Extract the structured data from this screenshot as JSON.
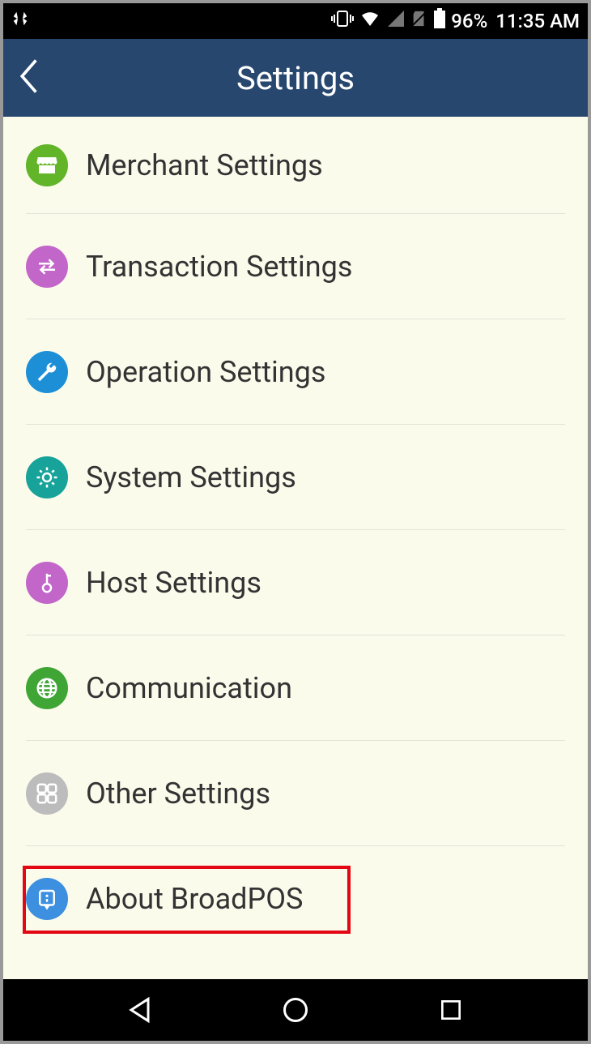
{
  "statusbar": {
    "battery_pct": "96%",
    "time": "11:35 AM"
  },
  "navbar": {
    "title": "Settings"
  },
  "settings": {
    "items": [
      {
        "label": "Merchant Settings",
        "icon": "store-icon",
        "color": "c-green"
      },
      {
        "label": "Transaction Settings",
        "icon": "swap-icon",
        "color": "c-violet"
      },
      {
        "label": "Operation Settings",
        "icon": "wrench-icon",
        "color": "c-blue"
      },
      {
        "label": "System Settings",
        "icon": "gear-icon",
        "color": "c-teal"
      },
      {
        "label": "Host Settings",
        "icon": "key-icon",
        "color": "c-violet"
      },
      {
        "label": "Communication",
        "icon": "globe-icon",
        "color": "c-green2"
      },
      {
        "label": "Other Settings",
        "icon": "grid-icon",
        "color": "c-gray"
      },
      {
        "label": "About BroadPOS",
        "icon": "info-icon",
        "color": "c-blue2"
      }
    ],
    "highlight_index": 7
  }
}
